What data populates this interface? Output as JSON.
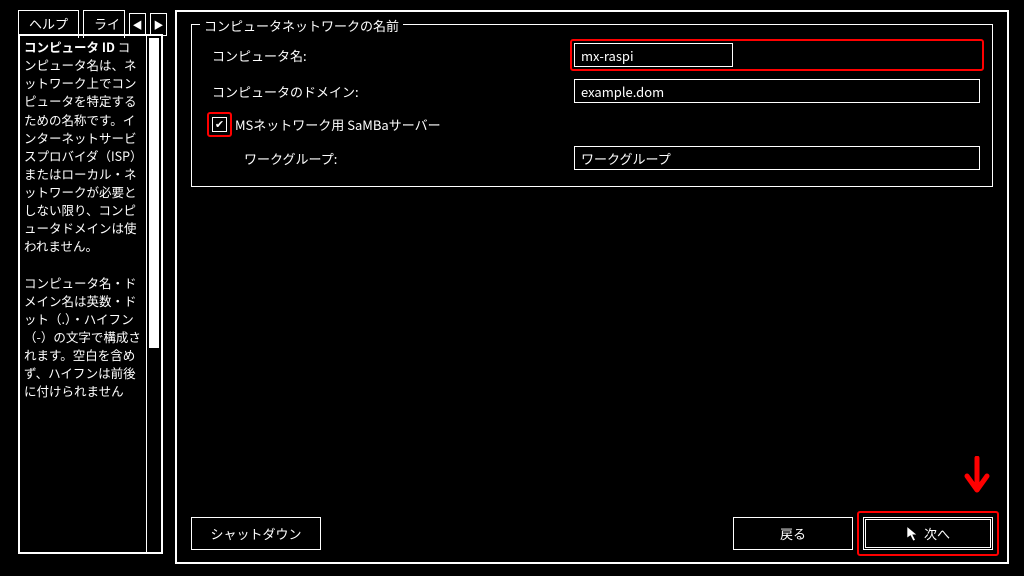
{
  "tabs": {
    "help": "ヘルプ",
    "live_partial": "ライ"
  },
  "help_panel": {
    "heading": "コンピュータ ID",
    "para1": "コンピュータ名は、ネットワーク上でコンピュータを特定するための名称です。インターネットサービスプロバイダ（ISP）またはローカル・ネットワークが必要としない限り、コンピュータドメインは使われません。",
    "para2": "コンピュータ名・ドメイン名は英数・ドット（.）・ハイフン（-）の文字で構成されます。空白を含めず、ハイフンは前後に付けられません"
  },
  "fieldset": {
    "legend": "コンピュータネットワークの名前",
    "computer_name_label": "コンピュータ名:",
    "computer_name_value": "mx-raspi",
    "domain_label": "コンピュータのドメイン:",
    "domain_value": "example.dom",
    "samba_label": "MSネットワーク用 SaMBaサーバー",
    "samba_checked": true,
    "workgroup_label": "ワークグループ:",
    "workgroup_value": "ワークグループ"
  },
  "buttons": {
    "shutdown": "シャットダウン",
    "back": "戻る",
    "next": "次へ"
  }
}
